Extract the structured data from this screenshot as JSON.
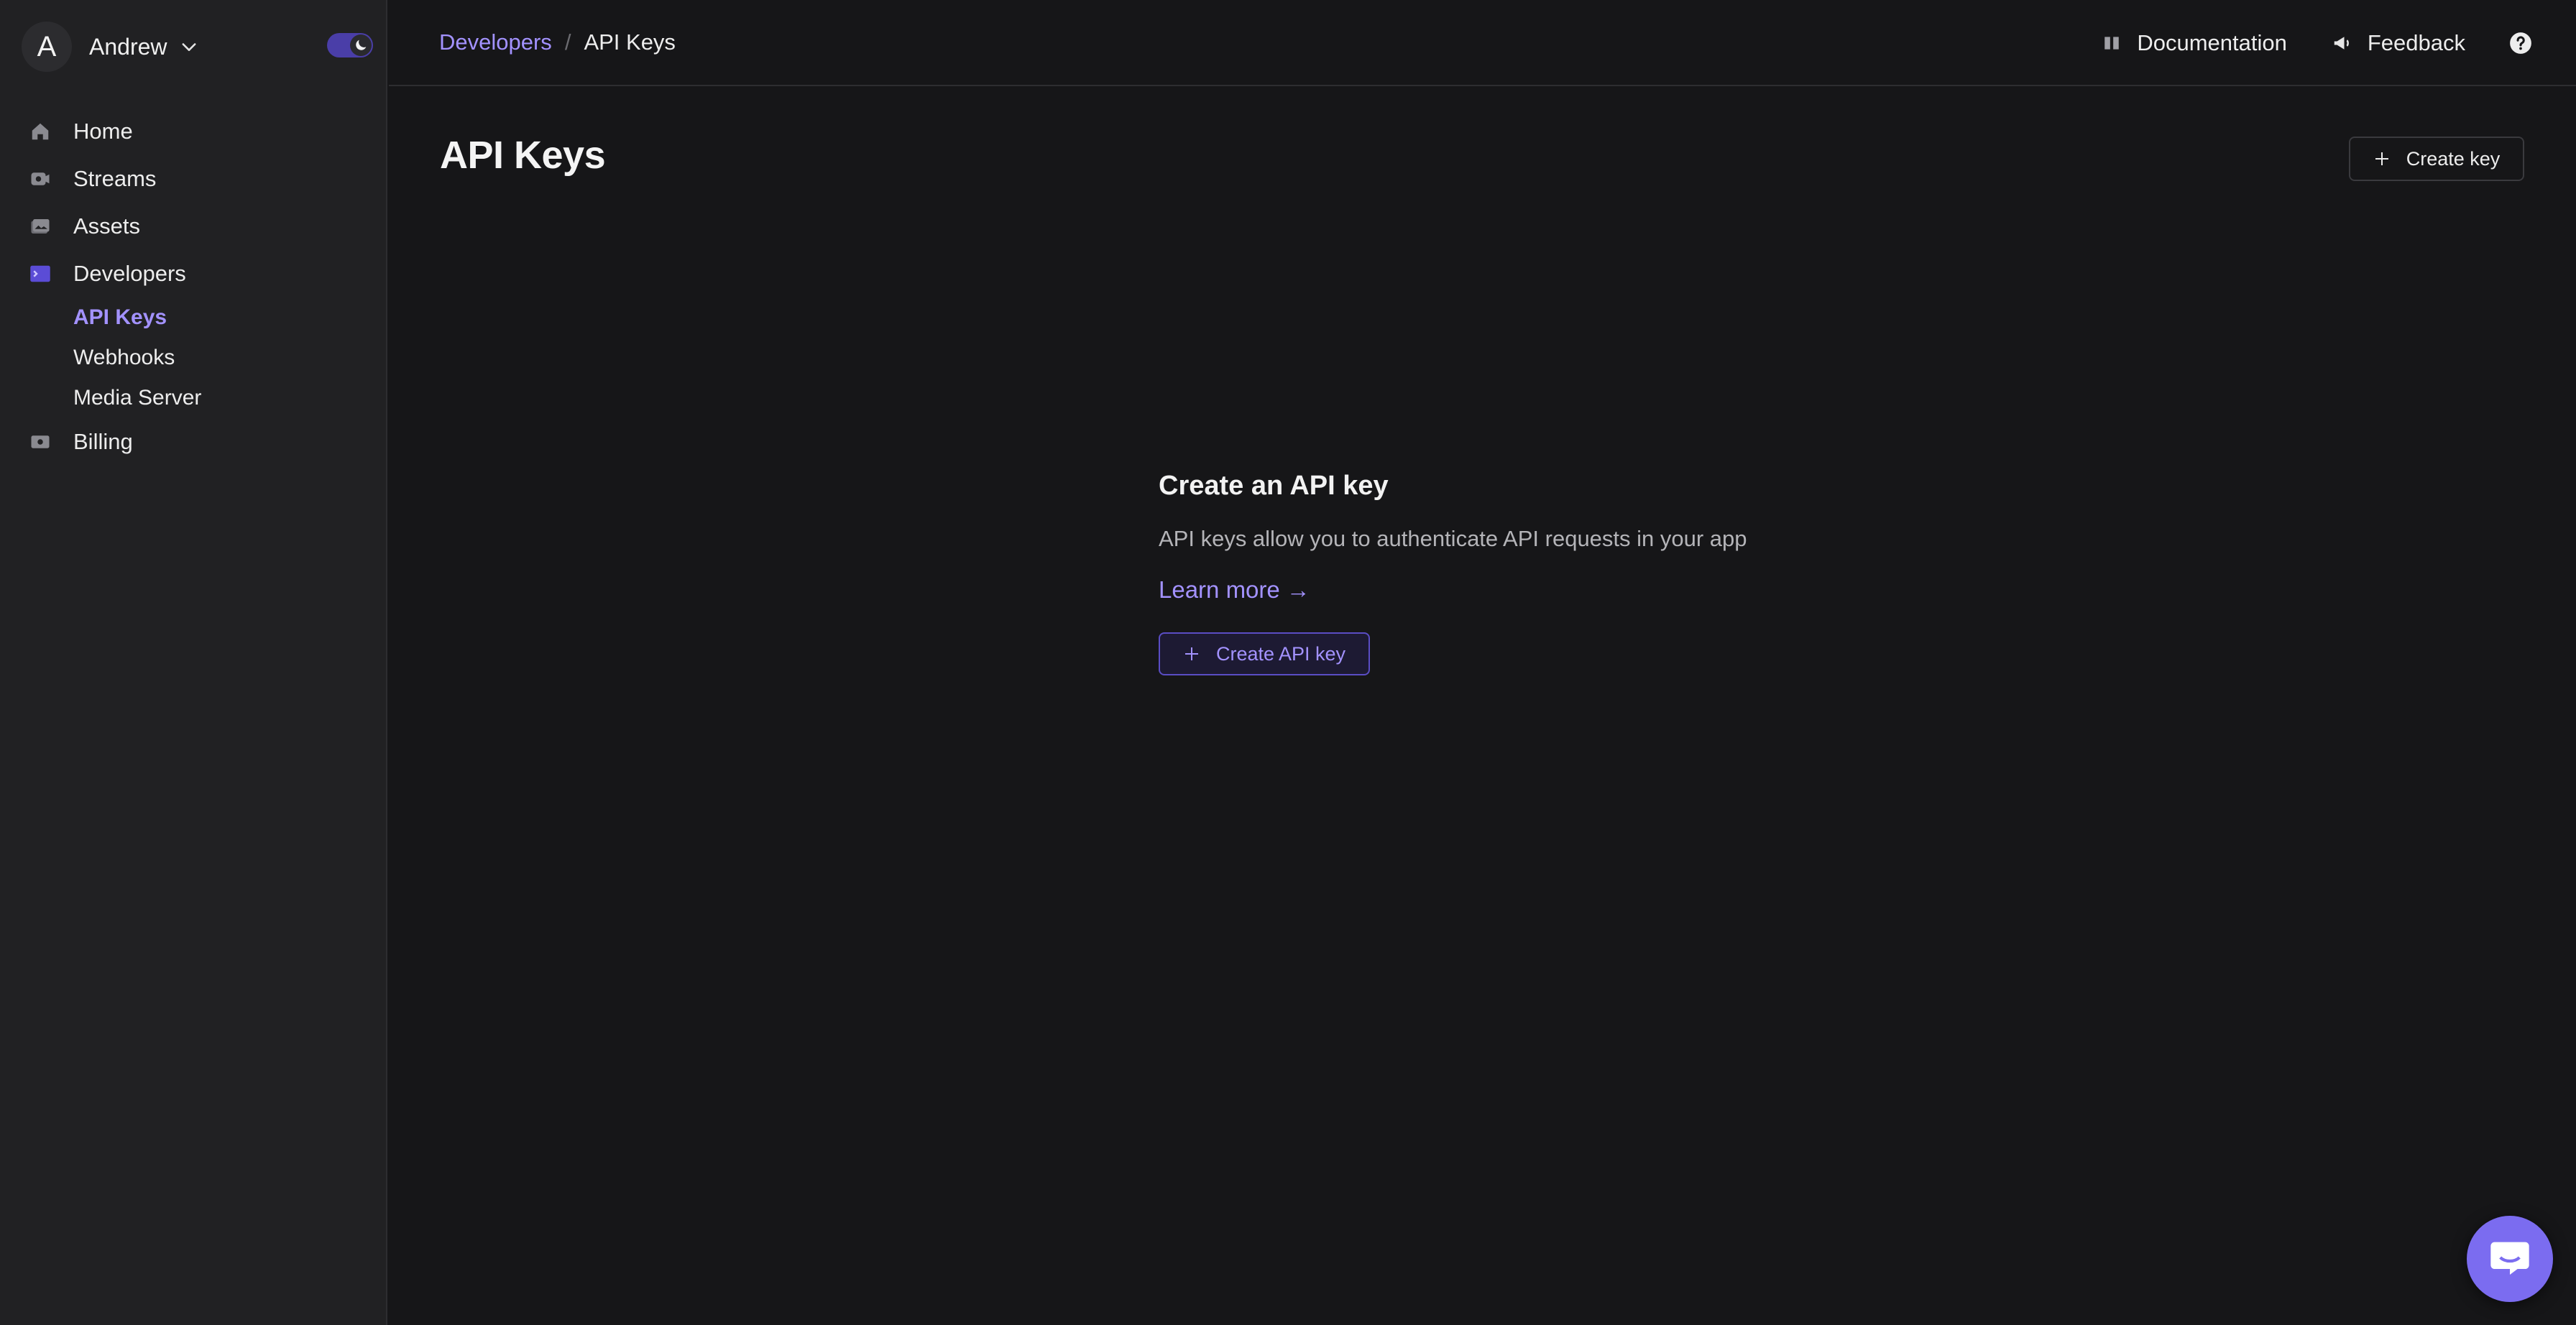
{
  "account": {
    "initial": "A",
    "name": "Andrew"
  },
  "sidebar": {
    "items": [
      {
        "label": "Home",
        "icon": "home-icon"
      },
      {
        "label": "Streams",
        "icon": "streams-icon"
      },
      {
        "label": "Assets",
        "icon": "assets-icon"
      },
      {
        "label": "Developers",
        "icon": "terminal-icon"
      },
      {
        "label": "Billing",
        "icon": "billing-icon"
      }
    ],
    "developers_sub": [
      {
        "label": "API Keys",
        "active": true
      },
      {
        "label": "Webhooks",
        "active": false
      },
      {
        "label": "Media Server",
        "active": false
      }
    ]
  },
  "breadcrumb": {
    "parent": "Developers",
    "separator": "/",
    "current": "API Keys"
  },
  "top_actions": {
    "documentation": "Documentation",
    "feedback": "Feedback"
  },
  "page": {
    "title": "API Keys",
    "create_key_label": "Create key"
  },
  "empty_state": {
    "title": "Create an API key",
    "description": "API keys allow you to authenticate API requests in your app",
    "learn_more": "Learn more →",
    "button_label": "Create API key"
  },
  "colors": {
    "accent": "#a392ff",
    "background": "#161618",
    "sidebar": "#212123"
  }
}
